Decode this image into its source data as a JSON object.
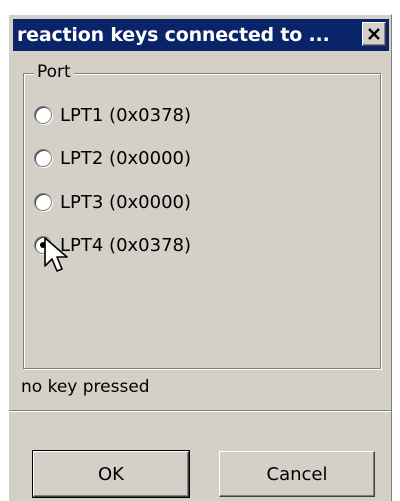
{
  "window": {
    "title": "reaction keys connected to ...",
    "close_glyph": "X"
  },
  "port_group": {
    "label": "Port",
    "options": [
      {
        "label": "LPT1 (0x0378)",
        "checked": false
      },
      {
        "label": "LPT2 (0x0000)",
        "checked": false
      },
      {
        "label": "LPT3 (0x0000)",
        "checked": false
      },
      {
        "label": "LPT4 (0x0378)",
        "checked": true
      }
    ]
  },
  "status_text": "no key pressed",
  "buttons": {
    "ok_label": "OK",
    "cancel_label": "Cancel"
  },
  "colors": {
    "titlebar": "#0a246a",
    "face": "#d4d0c8"
  }
}
